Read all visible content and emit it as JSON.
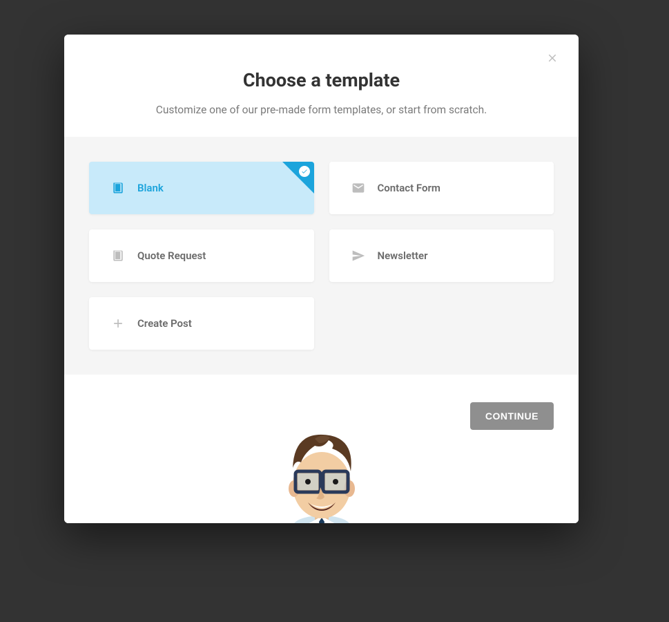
{
  "modal": {
    "title": "Choose a template",
    "subtitle": "Customize one of our pre-made form templates, or start from scratch."
  },
  "templates": [
    {
      "label": "Blank",
      "icon": "book",
      "selected": true
    },
    {
      "label": "Contact Form",
      "icon": "mail",
      "selected": false
    },
    {
      "label": "Quote Request",
      "icon": "book",
      "selected": false
    },
    {
      "label": "Newsletter",
      "icon": "send",
      "selected": false
    },
    {
      "label": "Create Post",
      "icon": "plus",
      "selected": false
    }
  ],
  "footer": {
    "continue_label": "CONTINUE"
  }
}
